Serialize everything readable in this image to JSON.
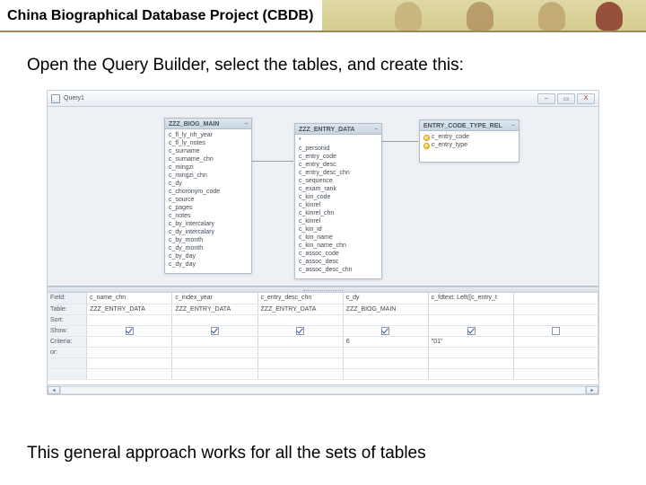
{
  "header": {
    "title": "China Biographical Database Project (CBDB)"
  },
  "intro_text": "Open the Query Builder, select the tables, and create this:",
  "conclusion_text": "This general approach works for all the sets of tables",
  "query_window": {
    "title": "Query1",
    "controls": {
      "min": "–",
      "max": "▭",
      "close": "X"
    },
    "tables": {
      "biog_main": {
        "caption": "ZZZ_BIOG_MAIN",
        "fields": [
          "c_fl_ly_nh_year",
          "c_fl_ly_notes",
          "c_surname",
          "c_surname_chn",
          "c_mingzi",
          "c_mingzi_chn",
          "c_dy",
          "c_choronym_code",
          "c_source",
          "c_pages",
          "c_notes",
          "c_by_intercalary",
          "c_dy_intercalary",
          "c_by_month",
          "c_dy_month",
          "c_by_day",
          "c_dy_day"
        ]
      },
      "entry_data": {
        "caption": "ZZZ_ENTRY_DATA",
        "fields": [
          "*",
          "c_personid",
          "c_entry_code",
          "c_entry_desc",
          "c_entry_desc_chn",
          "c_sequence",
          "c_exam_rank",
          "c_kin_code",
          "c_kinrel",
          "c_kinrel_chn",
          "c_kinrel",
          "c_kin_id",
          "c_kin_name",
          "c_kin_name_chn",
          "c_assoc_code",
          "c_assoc_desc",
          "c_assoc_desc_chn"
        ]
      },
      "entry_code_type_rel": {
        "caption": "ENTRY_CODE_TYPE_REL",
        "fields": [
          {
            "key": true,
            "name": "c_entry_code"
          },
          {
            "key": true,
            "name": "c_entry_type"
          }
        ]
      }
    },
    "grid": {
      "rows": [
        "Field:",
        "Table:",
        "Sort:",
        "Show:",
        "Criteria:",
        "or:"
      ],
      "columns": [
        {
          "field": "c_name_chn",
          "table": "ZZZ_ENTRY_DATA",
          "show": true,
          "criteria": "",
          "or": ""
        },
        {
          "field": "c_index_year",
          "table": "ZZZ_ENTRY_DATA",
          "show": true,
          "criteria": "",
          "or": ""
        },
        {
          "field": "c_entry_desc_chn",
          "table": "ZZZ_ENTRY_DATA",
          "show": true,
          "criteria": "",
          "or": ""
        },
        {
          "field": "c_dy",
          "table": "ZZZ_BIOG_MAIN",
          "show": true,
          "criteria": "6",
          "or": ""
        },
        {
          "field": "c_fdtext: Left([c_entry_t",
          "table": "",
          "show": true,
          "criteria": "\"01\"",
          "or": ""
        },
        {
          "field": "",
          "table": "",
          "show": false,
          "criteria": "",
          "or": ""
        }
      ]
    }
  }
}
